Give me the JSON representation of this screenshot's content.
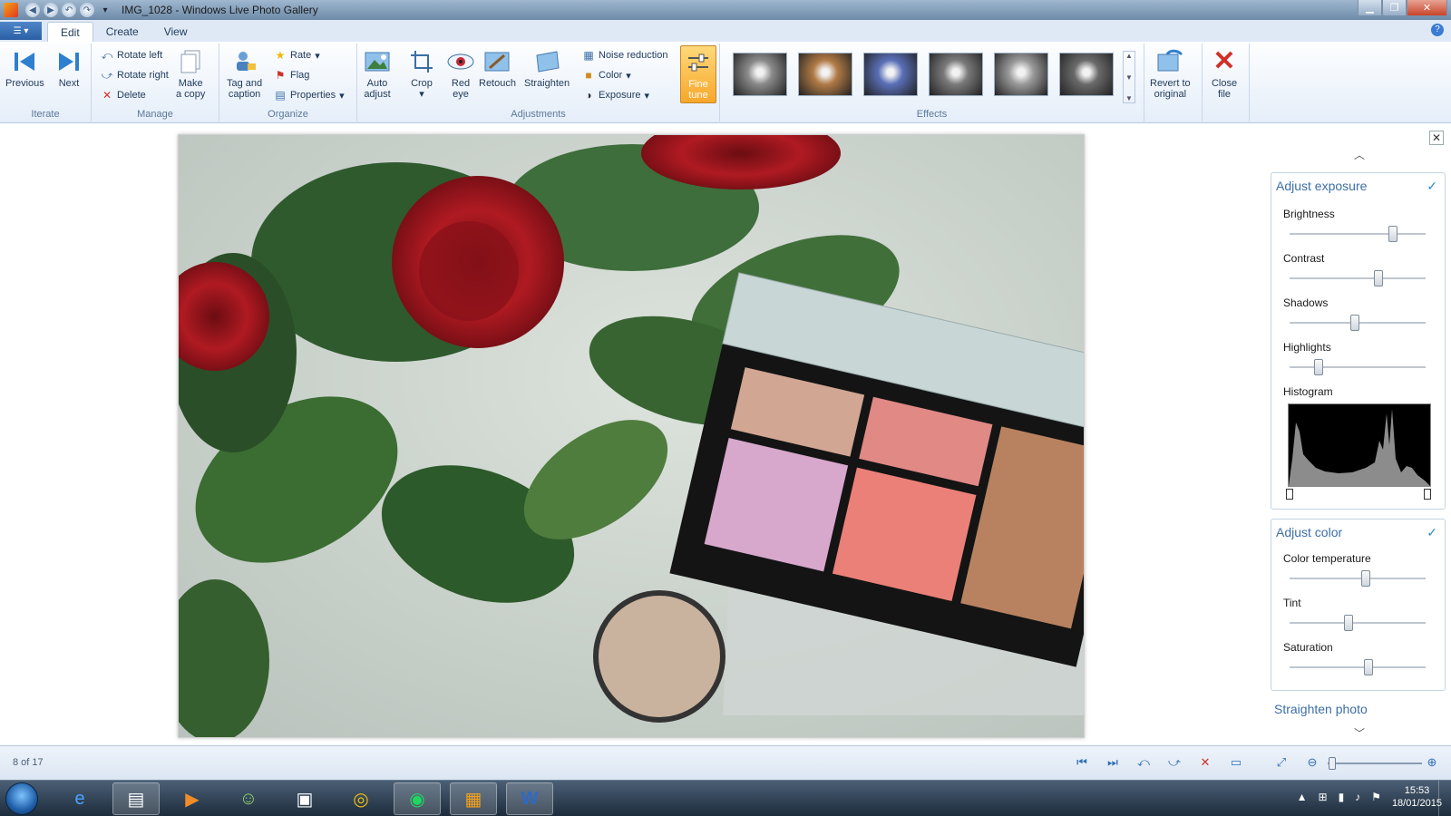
{
  "window": {
    "title": "IMG_1028 - Windows Live Photo Gallery"
  },
  "tabs": [
    {
      "label": "Edit",
      "active": true
    },
    {
      "label": "Create",
      "active": false
    },
    {
      "label": "View",
      "active": false
    }
  ],
  "ribbon": {
    "iterate": {
      "label": "Iterate",
      "previous": "Previous",
      "next": "Next"
    },
    "manage": {
      "label": "Manage",
      "rotate_left": "Rotate left",
      "rotate_right": "Rotate right",
      "delete": "Delete",
      "make_copy_1": "Make",
      "make_copy_2": "a copy"
    },
    "organize": {
      "label": "Organize",
      "tag_1": "Tag and",
      "tag_2": "caption",
      "rate": "Rate",
      "flag": "Flag",
      "properties": "Properties"
    },
    "adjustments": {
      "label": "Adjustments",
      "auto_1": "Auto",
      "auto_2": "adjust",
      "crop": "Crop",
      "red_1": "Red",
      "red_2": "eye",
      "retouch": "Retouch",
      "straighten": "Straighten",
      "noise": "Noise reduction",
      "color": "Color",
      "exposure": "Exposure",
      "fine_1": "Fine",
      "fine_2": "tune"
    },
    "effects": {
      "label": "Effects",
      "tints": [
        "#8a8a8a",
        "#b07a45",
        "#5a6fb8",
        "#7a7a7a",
        "#9a9a9a",
        "#6a6a6a"
      ]
    },
    "revert_1": "Revert to",
    "revert_2": "original",
    "close_1": "Close",
    "close_2": "file"
  },
  "panel": {
    "exposure": {
      "title": "Adjust exposure",
      "brightness": "Brightness",
      "contrast": "Contrast",
      "shadows": "Shadows",
      "highlights": "Highlights",
      "histogram": "Histogram",
      "levels": {
        "brightness": 0.76,
        "contrast": 0.65,
        "shadows": 0.48,
        "highlights": 0.21
      }
    },
    "color": {
      "title": "Adjust color",
      "temperature": "Color temperature",
      "tint": "Tint",
      "saturation": "Saturation",
      "levels": {
        "temperature": 0.56,
        "tint": 0.43,
        "saturation": 0.58
      }
    },
    "straighten": "Straighten photo"
  },
  "status": {
    "count": "8 of 17",
    "zoom": 0.05
  },
  "taskbar": {
    "time": "15:53",
    "date": "18/01/2015"
  }
}
